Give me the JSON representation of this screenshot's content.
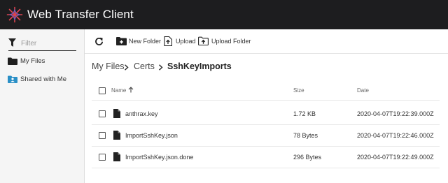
{
  "app": {
    "title": "Web Transfer Client",
    "logo_icon": "star-logo-icon",
    "header_bg": "#1d1d1f",
    "accent": "#d9363e"
  },
  "sidebar": {
    "filter_placeholder": "Filter",
    "items": [
      {
        "label": "My Files",
        "icon": "folder-icon"
      },
      {
        "label": "Shared with Me",
        "icon": "shared-folder-icon"
      }
    ]
  },
  "toolbar": {
    "refresh_icon": "refresh-icon",
    "new_folder_label": "New Folder",
    "upload_label": "Upload",
    "upload_folder_label": "Upload Folder"
  },
  "breadcrumb": {
    "items": [
      "My Files",
      "Certs",
      "SshKeyImports"
    ]
  },
  "table": {
    "columns": {
      "name": "Name",
      "size": "Size",
      "date": "Date"
    },
    "sort": {
      "column": "Name",
      "direction": "ascending"
    },
    "rows": [
      {
        "name": "anthrax.key",
        "size": "1.72 KB",
        "date": "2020-04-07T19:22:39.000Z"
      },
      {
        "name": "ImportSshKey.json",
        "size": "78 Bytes",
        "date": "2020-04-07T19:22:46.000Z"
      },
      {
        "name": "ImportSshKey.json.done",
        "size": "296 Bytes",
        "date": "2020-04-07T19:22:49.000Z"
      }
    ]
  }
}
